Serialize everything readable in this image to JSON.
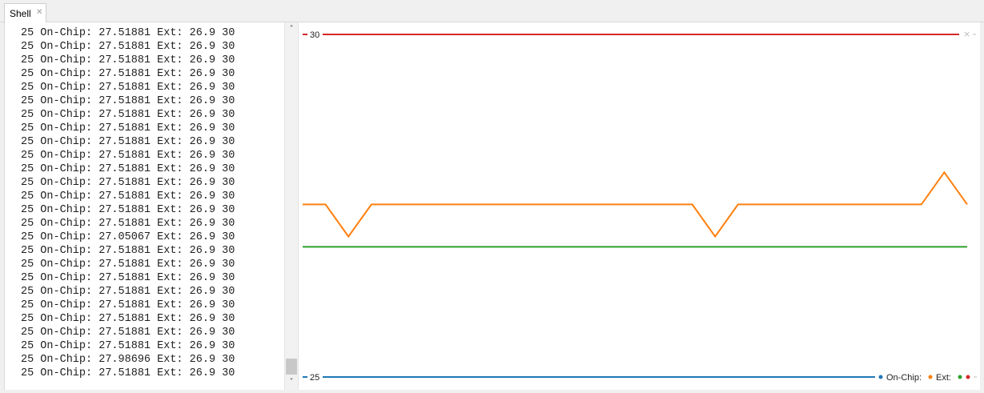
{
  "tab": {
    "label": "Shell",
    "close": "✕"
  },
  "shell_lines": [
    "25 On-Chip: 27.51881 Ext: 26.9 30",
    "25 On-Chip: 27.51881 Ext: 26.9 30",
    "25 On-Chip: 27.51881 Ext: 26.9 30",
    "25 On-Chip: 27.51881 Ext: 26.9 30",
    "25 On-Chip: 27.51881 Ext: 26.9 30",
    "25 On-Chip: 27.51881 Ext: 26.9 30",
    "25 On-Chip: 27.51881 Ext: 26.9 30",
    "25 On-Chip: 27.51881 Ext: 26.9 30",
    "25 On-Chip: 27.51881 Ext: 26.9 30",
    "25 On-Chip: 27.51881 Ext: 26.9 30",
    "25 On-Chip: 27.51881 Ext: 26.9 30",
    "25 On-Chip: 27.51881 Ext: 26.9 30",
    "25 On-Chip: 27.51881 Ext: 26.9 30",
    "25 On-Chip: 27.51881 Ext: 26.9 30",
    "25 On-Chip: 27.51881 Ext: 26.9 30",
    "25 On-Chip: 27.05067 Ext: 26.9 30",
    "25 On-Chip: 27.51881 Ext: 26.9 30",
    "25 On-Chip: 27.51881 Ext: 26.9 30",
    "25 On-Chip: 27.51881 Ext: 26.9 30",
    "25 On-Chip: 27.51881 Ext: 26.9 30",
    "25 On-Chip: 27.51881 Ext: 26.9 30",
    "25 On-Chip: 27.51881 Ext: 26.9 30",
    "25 On-Chip: 27.51881 Ext: 26.9 30",
    "25 On-Chip: 27.51881 Ext: 26.9 30",
    "25 On-Chip: 27.98696 Ext: 26.9 30",
    "25 On-Chip: 27.51881 Ext: 26.9 30"
  ],
  "scroll_icons": {
    "up": "up-arrow-icon",
    "down": "down-arrow-icon"
  },
  "chart_data": {
    "type": "line",
    "ylim": [
      25,
      30
    ],
    "yticks": [
      "30",
      "25"
    ],
    "x": [
      1,
      2,
      3,
      4,
      5,
      6,
      7,
      8,
      9,
      10,
      11,
      12,
      13,
      14,
      15,
      16,
      17,
      18,
      19,
      20,
      21,
      22,
      23,
      24,
      25,
      26,
      27,
      28,
      29,
      30
    ],
    "series": [
      {
        "name": "",
        "color": "#1f77b4",
        "values": [
          25,
          25,
          25,
          25,
          25,
          25,
          25,
          25,
          25,
          25,
          25,
          25,
          25,
          25,
          25,
          25,
          25,
          25,
          25,
          25,
          25,
          25,
          25,
          25,
          25,
          25,
          25,
          25,
          25,
          25
        ]
      },
      {
        "name": "On-Chip:",
        "color": "#ff7f0e",
        "values": [
          27.51881,
          27.51881,
          27.05067,
          27.51881,
          27.51881,
          27.51881,
          27.51881,
          27.51881,
          27.51881,
          27.51881,
          27.51881,
          27.51881,
          27.51881,
          27.51881,
          27.51881,
          27.51881,
          27.51881,
          27.51881,
          27.05067,
          27.51881,
          27.51881,
          27.51881,
          27.51881,
          27.51881,
          27.51881,
          27.51881,
          27.51881,
          27.51881,
          27.98696,
          27.51881
        ]
      },
      {
        "name": "Ext:",
        "color": "#2ca02c",
        "values": [
          26.9,
          26.9,
          26.9,
          26.9,
          26.9,
          26.9,
          26.9,
          26.9,
          26.9,
          26.9,
          26.9,
          26.9,
          26.9,
          26.9,
          26.9,
          26.9,
          26.9,
          26.9,
          26.9,
          26.9,
          26.9,
          26.9,
          26.9,
          26.9,
          26.9,
          26.9,
          26.9,
          26.9,
          26.9,
          26.9
        ]
      },
      {
        "name": "",
        "color": "#d62728",
        "values": [
          30,
          30,
          30,
          30,
          30,
          30,
          30,
          30,
          30,
          30,
          30,
          30,
          30,
          30,
          30,
          30,
          30,
          30,
          30,
          30,
          30,
          30,
          30,
          30,
          30,
          30,
          30,
          30,
          30,
          30
        ]
      }
    ],
    "legend_position": "bottom-right",
    "close_icon": "×"
  }
}
